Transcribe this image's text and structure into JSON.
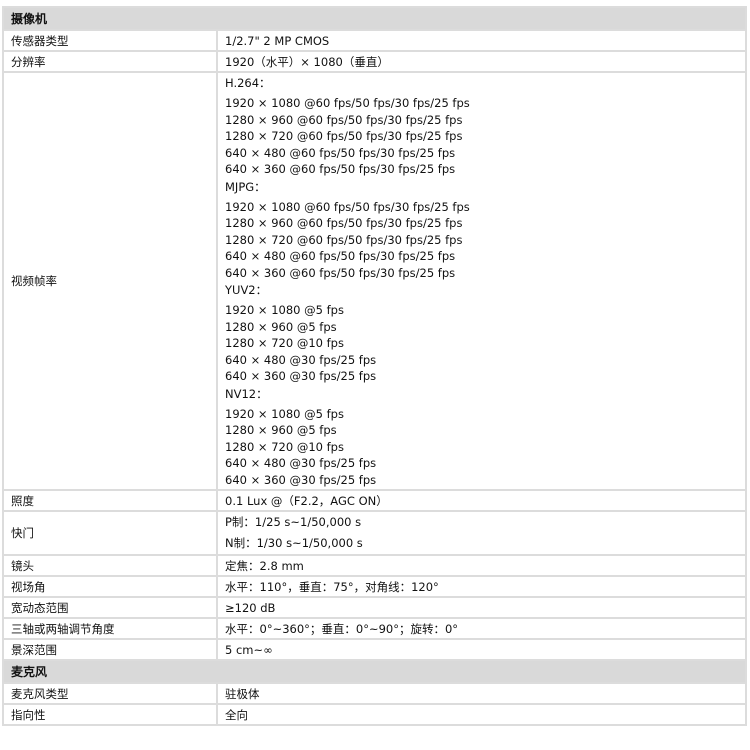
{
  "sections": [
    {
      "title": "摄像机",
      "rows": [
        {
          "label": "传感器类型",
          "value": "1/2.7\" 2 MP CMOS"
        },
        {
          "label": "分辨率",
          "value": "1920（水平）× 1080（垂直）"
        }
      ]
    }
  ],
  "frame_rate": {
    "label": "视频帧率",
    "groups": [
      {
        "title": "H.264：",
        "lines": [
          "1920 × 1080 @60 fps/50 fps/30 fps/25 fps",
          "1280 × 960 @60 fps/50 fps/30 fps/25 fps",
          "1280 × 720 @60 fps/50 fps/30 fps/25 fps",
          "640 × 480 @60 fps/50 fps/30 fps/25 fps",
          "640 × 360 @60 fps/50 fps/30 fps/25 fps"
        ]
      },
      {
        "title": "MJPG：",
        "lines": [
          "1920 × 1080 @60 fps/50 fps/30 fps/25 fps",
          "1280 × 960 @60 fps/50 fps/30 fps/25 fps",
          "1280 × 720 @60 fps/50 fps/30 fps/25 fps",
          "640 × 480 @60 fps/50 fps/30 fps/25 fps",
          "640 × 360 @60 fps/50 fps/30 fps/25 fps"
        ]
      },
      {
        "title": "YUV2：",
        "lines": [
          "1920 × 1080 @5 fps",
          "1280 × 960 @5 fps",
          "1280 × 720 @10 fps",
          "640 × 480 @30 fps/25 fps",
          "640 × 360 @30 fps/25 fps"
        ]
      },
      {
        "title": "NV12：",
        "lines": [
          "1920 × 1080 @5 fps",
          "1280 × 960 @5 fps",
          "1280 × 720 @10 fps",
          "640 × 480 @30 fps/25 fps",
          "640 × 360 @30 fps/25 fps"
        ]
      }
    ]
  },
  "illumination": {
    "label": "照度",
    "value": "0.1 Lux @（F2.2，AGC ON）"
  },
  "shutter": {
    "label": "快门",
    "lines": [
      "P制：1/25 s~1/50,000 s",
      "N制：1/30 s~1/50,000 s"
    ]
  },
  "camera_rows": [
    {
      "label": "镜头",
      "value": "定焦：2.8 mm"
    },
    {
      "label": "视场角",
      "value": "水平：110°，垂直：75°，对角线：120°"
    },
    {
      "label": "宽动态范围",
      "value": "≥120 dB"
    },
    {
      "label": "三轴或两轴调节角度",
      "value": "水平：0°~360°；垂直：0°~90°；旋转：0°"
    },
    {
      "label": "景深范围",
      "value": "5 cm~∞"
    }
  ],
  "microphone": {
    "title": "麦克风",
    "rows": [
      {
        "label": "麦克风类型",
        "value": "驻极体"
      },
      {
        "label": "指向性",
        "value": "全向"
      }
    ]
  }
}
